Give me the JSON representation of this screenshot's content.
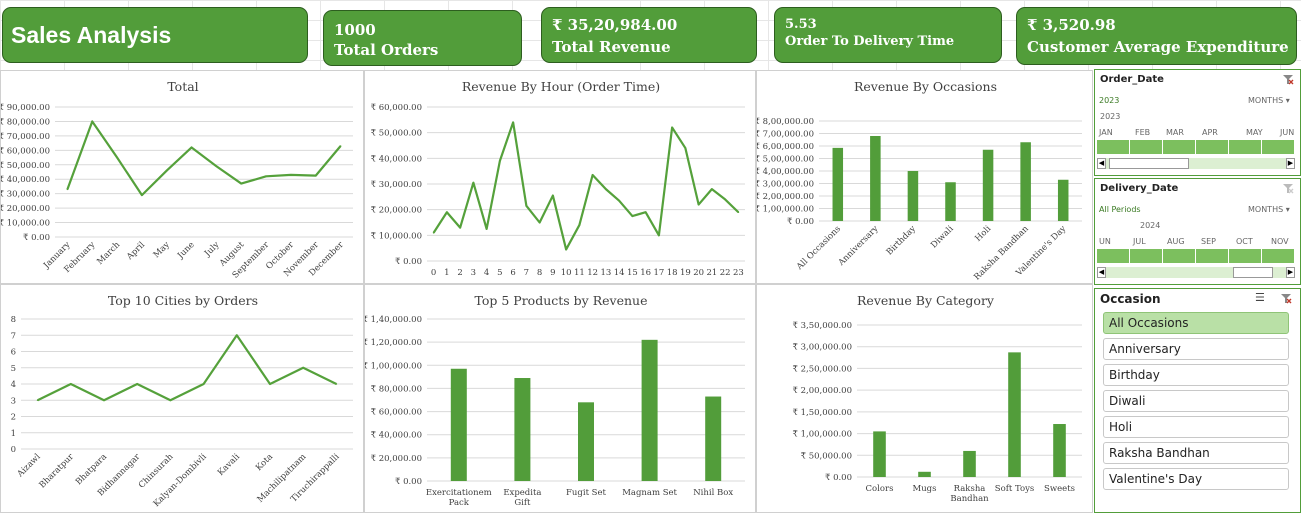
{
  "header": {
    "title": "Sales Analysis",
    "kpis": [
      {
        "value": "1000",
        "label": "Total Orders"
      },
      {
        "value": "₹ 35,20,984.00",
        "label": "Total Revenue"
      },
      {
        "value": "5.53",
        "label": "Order To Delivery Time"
      },
      {
        "value": "₹ 3,520.98",
        "label": "Customer Average Expenditure"
      }
    ]
  },
  "colors": {
    "accent": "#529d3a",
    "line": "#55a13b",
    "selected": "#b9e0a6"
  },
  "chart_data": [
    {
      "type": "line",
      "title": "Total",
      "categories": [
        "January",
        "February",
        "March",
        "April",
        "May",
        "June",
        "July",
        "August",
        "September",
        "October",
        "November",
        "December"
      ],
      "values": [
        33000,
        80000,
        55000,
        29000,
        46000,
        62000,
        49000,
        37000,
        42000,
        43000,
        42500,
        63000
      ],
      "ylim": [
        0,
        90000
      ],
      "yticks": [
        "₹ 0.00",
        "₹ 10,000.00",
        "₹ 20,000.00",
        "₹ 30,000.00",
        "₹ 40,000.00",
        "₹ 50,000.00",
        "₹ 60,000.00",
        "₹ 70,000.00",
        "₹ 80,000.00",
        "₹ 90,000.00"
      ],
      "grid": true
    },
    {
      "type": "line",
      "title": "Revenue By Hour (Order Time)",
      "categories": [
        "0",
        "1",
        "2",
        "3",
        "4",
        "5",
        "6",
        "7",
        "8",
        "9",
        "10",
        "11",
        "12",
        "13",
        "14",
        "15",
        "16",
        "17",
        "18",
        "19",
        "20",
        "21",
        "22",
        "23"
      ],
      "values": [
        11000,
        19000,
        13000,
        30500,
        12500,
        39000,
        54000,
        21500,
        15000,
        25500,
        4500,
        14000,
        33500,
        28000,
        23500,
        17500,
        19000,
        10000,
        52000,
        44000,
        22000,
        28000,
        24000,
        19000
      ],
      "ylim": [
        0,
        60000
      ],
      "yticks": [
        "₹ 0.00",
        "₹ 10,000.00",
        "₹ 20,000.00",
        "₹ 30,000.00",
        "₹ 40,000.00",
        "₹ 50,000.00",
        "₹ 60,000.00"
      ],
      "grid": true
    },
    {
      "type": "bar",
      "title": "Revenue By Occasions",
      "categories": [
        "All Occasions",
        "Anniversary",
        "Birthday",
        "Diwali",
        "Holi",
        "Raksha Bandhan",
        "Valentine's Day"
      ],
      "values": [
        585000,
        680000,
        400000,
        310000,
        570000,
        630000,
        330000
      ],
      "ylim": [
        0,
        800000
      ],
      "yticks": [
        "₹ 0.00",
        "₹ 1,00,000.00",
        "₹ 2,00,000.00",
        "₹ 3,00,000.00",
        "₹ 4,00,000.00",
        "₹ 5,00,000.00",
        "₹ 6,00,000.00",
        "₹ 7,00,000.00",
        "₹ 8,00,000.00"
      ],
      "grid": true
    },
    {
      "type": "line",
      "title": "Top 10 Cities by Orders",
      "categories": [
        "Aizawl",
        "Bharatpur",
        "Bhatpara",
        "Bidhannagar",
        "Chinsurah",
        "Kalyan-Dombivli",
        "Kavali",
        "Kota",
        "Machilipatnam",
        "Tiruchirappalli"
      ],
      "values": [
        3,
        4,
        3,
        4,
        3,
        4,
        7,
        4,
        5,
        4
      ],
      "ylim": [
        0,
        8
      ],
      "yticks": [
        "0",
        "1",
        "2",
        "3",
        "4",
        "5",
        "6",
        "7",
        "8"
      ],
      "grid": true
    },
    {
      "type": "bar",
      "title": "Top 5 Products by Revenue",
      "categories": [
        "Exercitationem Pack",
        "Expedita Gift",
        "Fugit Set",
        "Magnam Set",
        "Nihil Box"
      ],
      "values": [
        97000,
        89000,
        68000,
        122000,
        73000
      ],
      "ylim": [
        0,
        140000
      ],
      "yticks": [
        "₹ 0.00",
        "₹ 20,000.00",
        "₹ 40,000.00",
        "₹ 60,000.00",
        "₹ 80,000.00",
        "₹ 1,00,000.00",
        "₹ 1,20,000.00",
        "₹ 1,40,000.00"
      ],
      "grid": true
    },
    {
      "type": "bar",
      "title": "Revenue By Category",
      "categories": [
        "Colors",
        "Mugs",
        "Raksha Bandhan",
        "Soft Toys",
        "Sweets"
      ],
      "values": [
        105000,
        12000,
        60000,
        287000,
        122000
      ],
      "ylim": [
        0,
        350000
      ],
      "yticks": [
        "₹ 0.00",
        "₹ 50,000.00",
        "₹ 1,00,000.00",
        "₹ 1,50,000.00",
        "₹ 2,00,000.00",
        "₹ 2,50,000.00",
        "₹ 3,00,000.00",
        "₹ 3,50,000.00"
      ],
      "grid": true
    }
  ],
  "slicers": {
    "order_date": {
      "title": "Order_Date",
      "selection": "2023",
      "level": "MONTHS",
      "year": "2023",
      "months": [
        "JAN",
        "FEB",
        "MAR",
        "APR",
        "MAY",
        "JUN"
      ]
    },
    "delivery_date": {
      "title": "Delivery_Date",
      "selection": "All Periods",
      "level": "MONTHS",
      "year": "2024",
      "months": [
        "UN",
        "JUL",
        "AUG",
        "SEP",
        "OCT",
        "NOV"
      ]
    },
    "occasion": {
      "title": "Occasion",
      "items": [
        "All Occasions",
        "Anniversary",
        "Birthday",
        "Diwali",
        "Holi",
        "Raksha Bandhan",
        "Valentine's Day"
      ],
      "selected": "All Occasions"
    }
  }
}
